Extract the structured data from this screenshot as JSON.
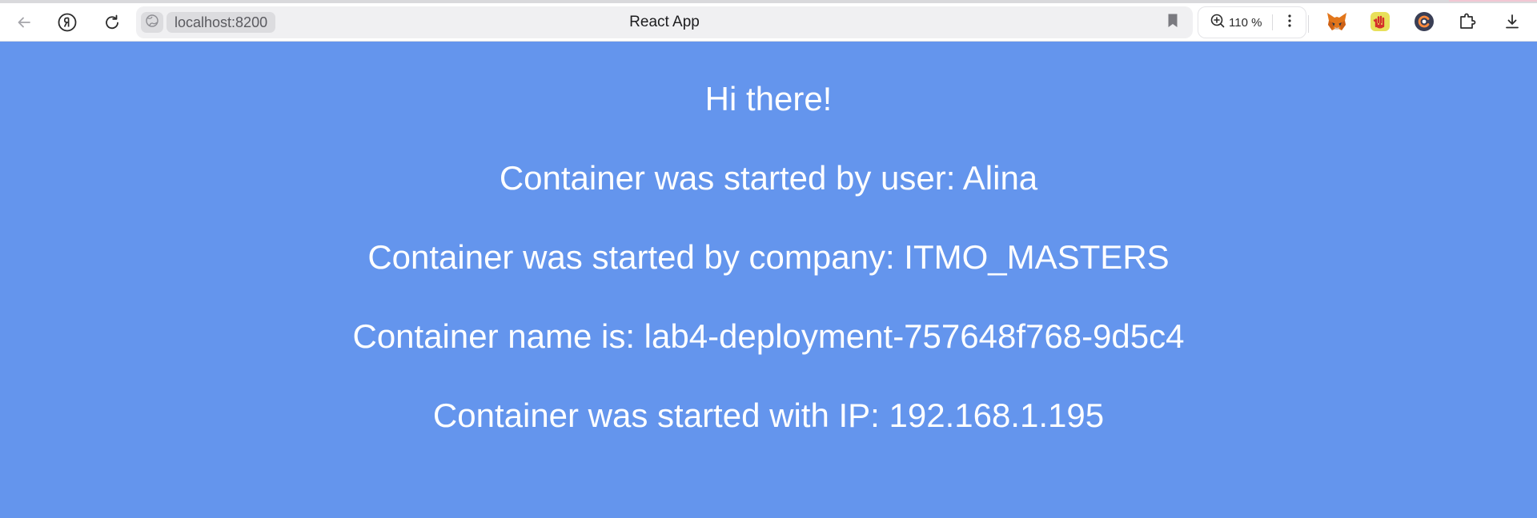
{
  "browser": {
    "url": "localhost:8200",
    "tab_title": "React App",
    "zoom": "110 %",
    "icons": {
      "back": "back-arrow-icon",
      "yandex": "yandex-logo-icon",
      "reload": "reload-icon",
      "site": "site-globe-icon",
      "bookmark": "bookmark-icon",
      "zoom": "zoom-in-icon",
      "more": "more-vertical-icon",
      "ext_fox": "metamask-fox-icon",
      "ext_hand": "hand-extension-icon",
      "ext_c": "circle-c-extension-icon",
      "ext_puzzle": "extensions-puzzle-icon",
      "download": "download-icon"
    }
  },
  "page": {
    "background": "#6495ed",
    "text_color": "#ffffff",
    "lines": [
      "Hi there!",
      "Container was started by user: Alina",
      "Container was started by company: ITMO_MASTERS",
      "Container name is: lab4-deployment-757648f768-9d5c4",
      "Container was started with IP: 192.168.1.195"
    ]
  }
}
